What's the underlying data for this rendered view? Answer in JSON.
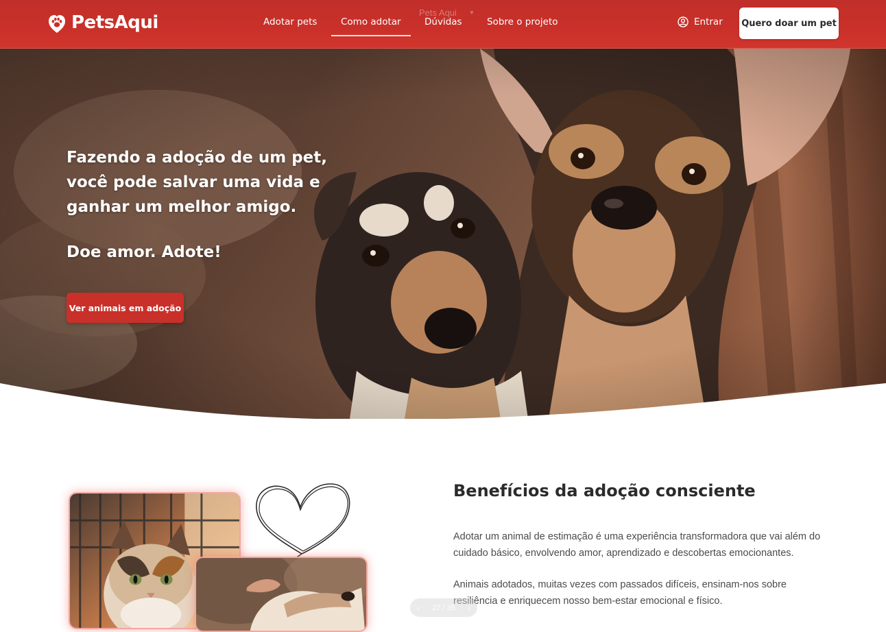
{
  "header": {
    "logo_text": "PetsAqui",
    "ghost_title": "Pets Aqui",
    "nav": [
      {
        "label": "Adotar pets"
      },
      {
        "label": "Como adotar"
      },
      {
        "label": "Dúvidas"
      },
      {
        "label": "Sobre o projeto"
      }
    ],
    "active_nav": "Como adotar",
    "login_label": "Entrar",
    "donate_label": "Quero doar um pet"
  },
  "hero": {
    "title_lines": [
      "Fazendo a adoção de um pet,",
      "você pode salvar uma vida e",
      "ganhar um melhor amigo."
    ],
    "subtitle": "Doe amor. Adote!",
    "cta_label": "Ver animais em adoção"
  },
  "benefits": {
    "title": "Benefícios da adoção consciente",
    "paragraphs": [
      "Adotar um animal de estimação é uma experiência transformadora que vai além do cuidado básico, envolvendo amor, aprendizado e descobertas emocionantes.",
      "Animais adotados, muitas vezes com passados difíceis, ensinam-nos sobre resiliência e enriquecem nosso bem-estar emocional e físico."
    ]
  },
  "pager": {
    "text": "27 / 35"
  },
  "colors": {
    "brand_red": "#c93029",
    "text_dark": "#2b2b2b",
    "text_body": "#4b4b4b"
  },
  "icons": {
    "logo": "paw-heart-icon",
    "login": "user-circle-icon",
    "pager_prev": "chevron-left-icon",
    "pager_next": "chevron-right-icon"
  }
}
